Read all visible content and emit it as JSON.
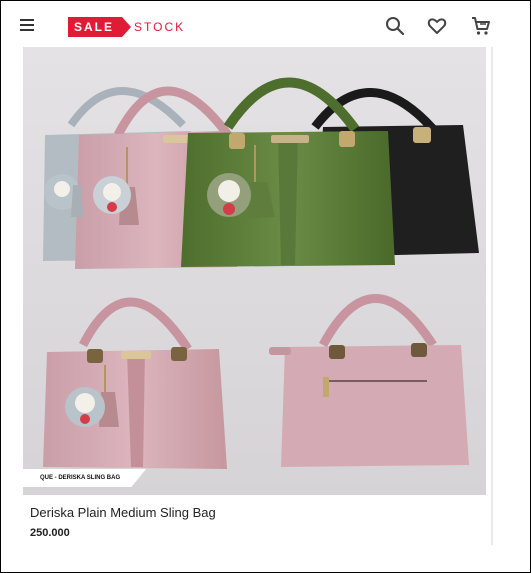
{
  "header": {
    "logo": {
      "sale_text": "SALE",
      "stock_text": "STOCK",
      "brand_color": "#e01b35"
    },
    "icons": [
      "menu-icon",
      "search-icon",
      "heart-icon",
      "cart-icon"
    ]
  },
  "product": {
    "image_label": "QUE - DERISKA SLING BAG",
    "name": "Deriska Plain Medium Sling Bag",
    "price": "250.000"
  },
  "colors": {
    "bag_grey": "#b4bcc3",
    "bag_pink": "#d6b0b8",
    "bag_green": "#5b7a39",
    "bag_black": "#1e1e1e"
  }
}
